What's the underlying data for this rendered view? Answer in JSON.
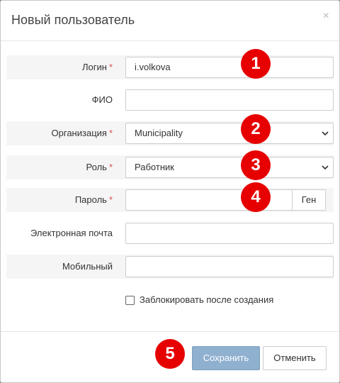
{
  "modal": {
    "title": "Новый пользователь",
    "close_symbol": "×"
  },
  "form": {
    "login": {
      "label": "Логин",
      "value": "i.volkova",
      "required": "*"
    },
    "fio": {
      "label": "ФИО",
      "value": ""
    },
    "organization": {
      "label": "Организация",
      "selected": "Municipality",
      "required": "*"
    },
    "role": {
      "label": "Роль",
      "selected": "Работник",
      "required": "*"
    },
    "password": {
      "label": "Пароль",
      "value": "",
      "required": "*",
      "gen_button": "Ген"
    },
    "email": {
      "label": "Электронная почта",
      "value": ""
    },
    "mobile": {
      "label": "Мобильный",
      "value": ""
    },
    "block_checkbox": {
      "label": "Заблокировать после создания",
      "checked": false
    }
  },
  "buttons": {
    "save": "Сохранить",
    "cancel": "Отменить"
  },
  "badges": [
    "1",
    "2",
    "3",
    "4",
    "5"
  ],
  "colors": {
    "badge": "#e60000",
    "required": "#d9534f",
    "save_button": "#8fb0cf"
  }
}
